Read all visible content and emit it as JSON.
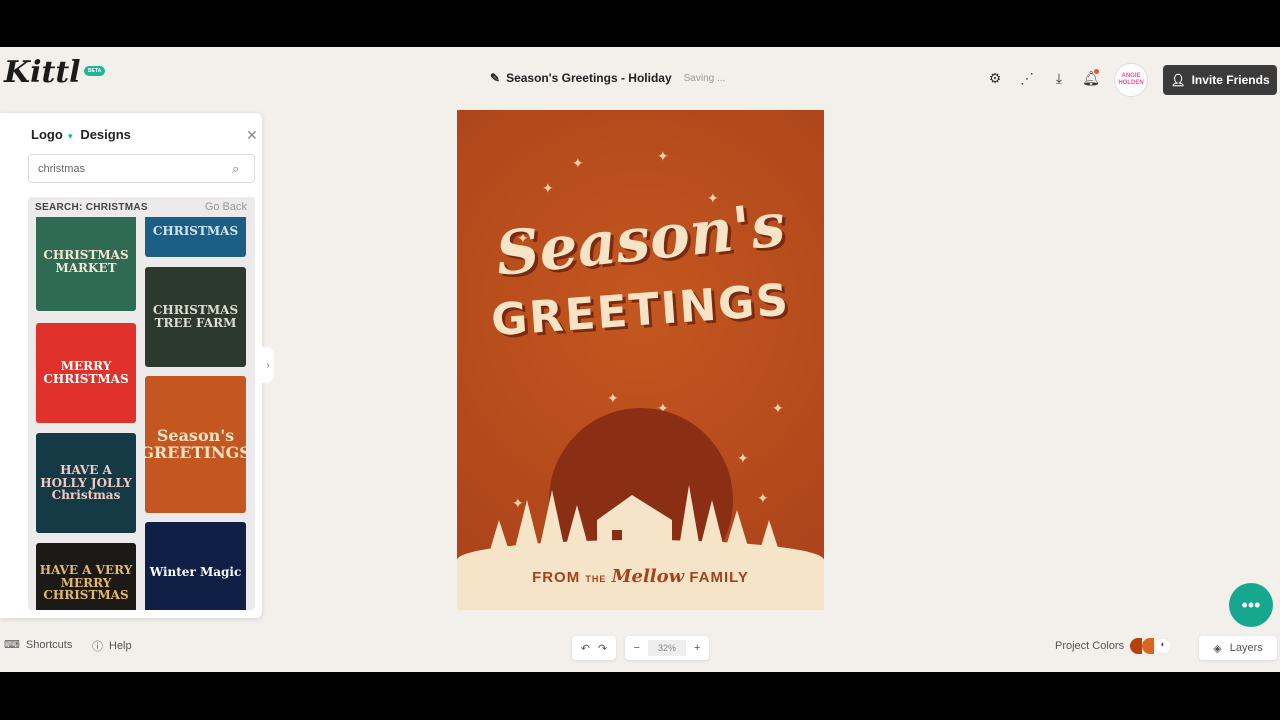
{
  "app": {
    "logo": "Kittl",
    "badge": "BETA"
  },
  "header": {
    "title": "Season's Greetings - Holiday",
    "status": "Saving ...",
    "avatar_text": "ANGIE HOLDEN",
    "invite_label": "Invite Friends",
    "icons": [
      "settings-icon",
      "share-icon",
      "download-icon",
      "notification-icon"
    ]
  },
  "panel": {
    "tab_dropdown": "Logo",
    "tab_active": "Designs",
    "search_value": "christmas",
    "search_placeholder": "Search",
    "results_heading": "SEARCH: CHRISTMAS",
    "go_back": "Go Back",
    "results": [
      {
        "title": "CHRISTMAS MARKET",
        "bg": "#2f6a55",
        "fg": "#f3e7cf"
      },
      {
        "title": "CHRISTMAS",
        "bg": "#1b5f86",
        "fg": "#cfe3f0"
      },
      {
        "title": "MERRY CHRISTMAS",
        "bg": "#e0322a",
        "fg": "#fff"
      },
      {
        "title": "CHRISTMAS TREE FARM",
        "bg": "#2c3a2e",
        "fg": "#dcdcd0"
      },
      {
        "title": "HAVE A HOLLY JOLLY Christmas",
        "bg": "#143b45",
        "fg": "#f5c9c0"
      },
      {
        "title": "Season's GREETINGS",
        "bg": "#c4571f",
        "fg": "#f7e3c6"
      },
      {
        "title": "HAVE A VERY MERRY CHRISTMAS",
        "bg": "#1c1a17",
        "fg": "#e3b86a"
      },
      {
        "title": "Winter Magic",
        "bg": "#0f1f45",
        "fg": "#fff"
      }
    ]
  },
  "canvas": {
    "line1": "Season's",
    "line2": "GREETINGS",
    "from": "FROM",
    "the": "THE",
    "name": "Mellow",
    "family": "FAMILY"
  },
  "footer": {
    "shortcuts": "Shortcuts",
    "help": "Help",
    "zoom": "32%",
    "project_colors": "Project Colors",
    "layers": "Layers",
    "colors": [
      "#b8400f",
      "#d9661c"
    ]
  }
}
